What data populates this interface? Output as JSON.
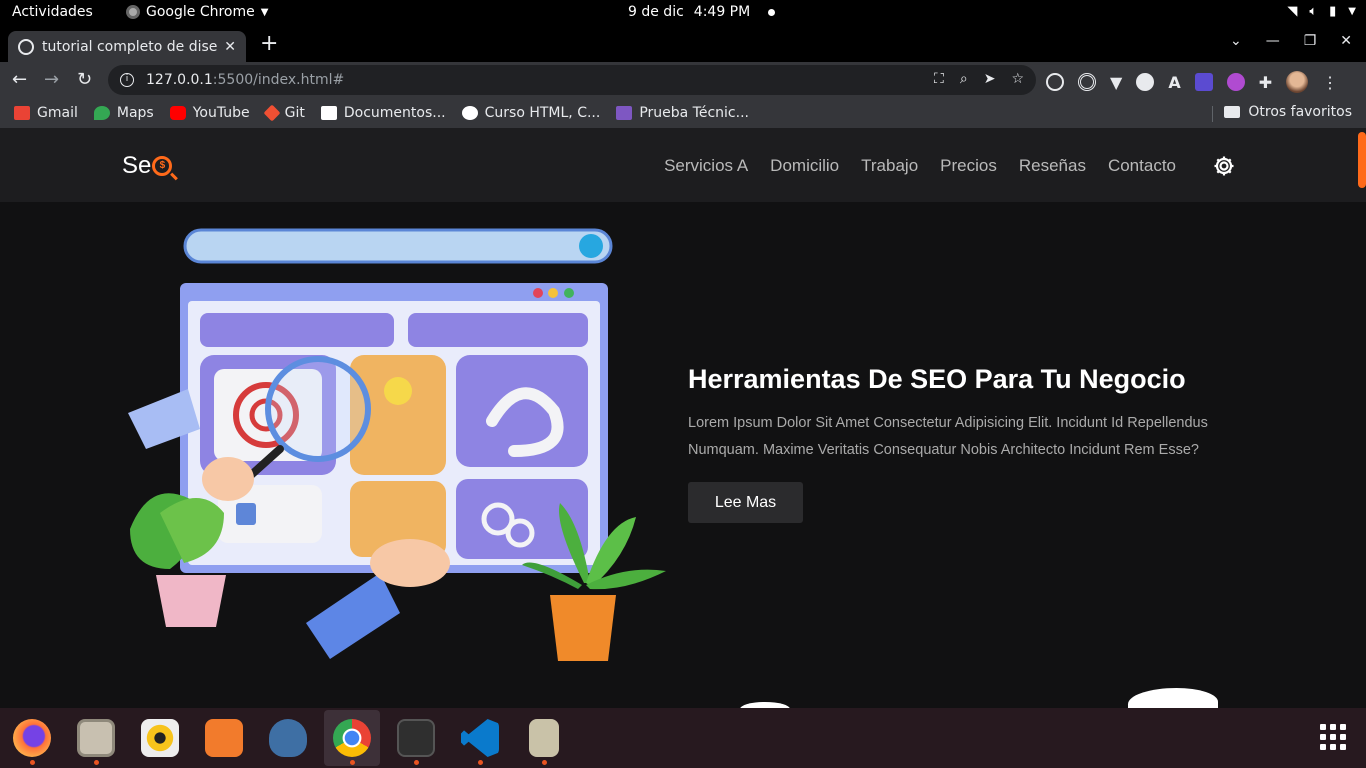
{
  "gnome": {
    "activities": "Actividades",
    "app_name": "Google Chrome",
    "date": "9 de dic",
    "time": "4:49 PM"
  },
  "browser": {
    "tab_title": "tutorial completo de diser",
    "url_host": "127.0.0.1",
    "url_path": ":5500/index.html#",
    "bookmarks": [
      {
        "label": "Gmail",
        "color": "#ea4335"
      },
      {
        "label": "Maps",
        "color": "#34a853"
      },
      {
        "label": "YouTube",
        "color": "#ff0000"
      },
      {
        "label": "Git",
        "color": "#f05033"
      },
      {
        "label": "Documentos...",
        "color": "#ffffff"
      },
      {
        "label": "Curso HTML, C...",
        "color": "#ffffff"
      },
      {
        "label": "Prueba Técnic...",
        "color": "#7e57c2"
      }
    ],
    "other_bookmarks": "Otros favoritos"
  },
  "site": {
    "logo_text": "Se",
    "logo_symbol": "$",
    "nav": [
      "Servicios A",
      "Domicilio",
      "Trabajo",
      "Precios",
      "Reseñas",
      "Contacto"
    ],
    "accent": "#ff6a1a",
    "hero": {
      "title": "Herramientas De SEO Para Tu Negocio",
      "text": "Lorem Ipsum Dolor Sit Amet Consectetur Adipisicing Elit. Incidunt Id Repellendus Numquam. Maxime Veritatis Consequatur Nobis Architecto Incidunt Rem Esse?",
      "button": "Lee Mas"
    }
  },
  "dock": {
    "apps": [
      {
        "name": "firefox-icon",
        "color": "#ff7139"
      },
      {
        "name": "files-icon",
        "color": "#c8c0b0"
      },
      {
        "name": "rhythmbox-icon",
        "color": "#f7c31b"
      },
      {
        "name": "software-icon",
        "color": "#f27b2c"
      },
      {
        "name": "pgadmin-icon",
        "color": "#3e6fa4"
      },
      {
        "name": "chrome-icon",
        "color": "#4285f4"
      },
      {
        "name": "terminal-icon",
        "color": "#2f2f2f"
      },
      {
        "name": "vscode-icon",
        "color": "#0a7acc"
      },
      {
        "name": "archive-icon",
        "color": "#c9c2a8"
      }
    ]
  }
}
